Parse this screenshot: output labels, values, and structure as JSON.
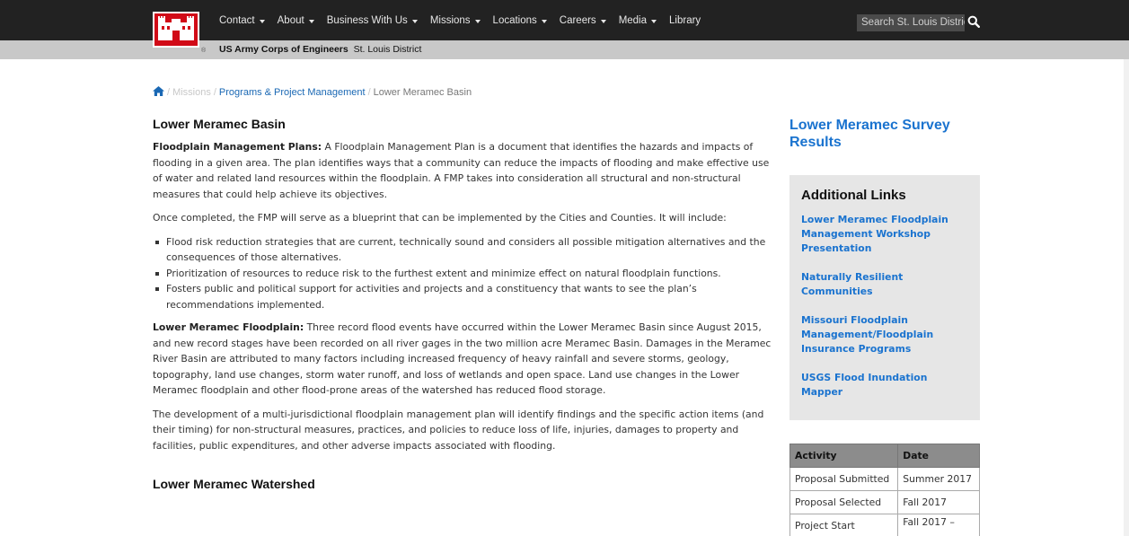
{
  "nav": {
    "items": [
      {
        "label": "Contact",
        "has_dropdown": true
      },
      {
        "label": "About",
        "has_dropdown": true
      },
      {
        "label": "Business With Us",
        "has_dropdown": true
      },
      {
        "label": "Missions",
        "has_dropdown": true
      },
      {
        "label": "Locations",
        "has_dropdown": true
      },
      {
        "label": "Careers",
        "has_dropdown": true
      },
      {
        "label": "Media",
        "has_dropdown": true
      },
      {
        "label": "Library",
        "has_dropdown": false
      }
    ],
    "search_placeholder": "Search St. Louis District",
    "search_icon": "search-icon",
    "org_name": "US Army Corps of Engineers",
    "district": "St. Louis District",
    "logo_reg": "®",
    "colors": {
      "topbar": "#222222",
      "subbar": "#c8c8c8",
      "logo": "#d10a17"
    }
  },
  "breadcrumb": {
    "home_icon": "home-icon",
    "items": [
      "Missions",
      "Programs & Project Management",
      "Lower Meramec Basin"
    ],
    "separator": "/"
  },
  "main": {
    "title": "Lower Meramec Basin",
    "p1_label": "Floodplain Management Plans:",
    "p1_text": " A Floodplain Management Plan is a document that identifies the hazards and impacts of flooding in a given area. The plan identifies ways that a community can reduce the impacts of flooding and make effective use of water and related land resources within the floodplain. A FMP takes into consideration all structural and non-structural measures that could help achieve its objectives.",
    "p2": "Once completed, the FMP will serve as a blueprint that can be implemented by the Cities and Counties. It will include:",
    "bullets": [
      "Flood risk reduction strategies that are current, technically sound and considers all possible mitigation alternatives and the consequences of those alternatives.",
      "Prioritization of resources to reduce risk to the furthest extent and minimize effect on natural floodplain functions.",
      "Fosters public and political support for activities and projects and a constituency that wants to see the plan’s recommendations implemented."
    ],
    "p3_label": "Lower Meramec Floodplain:",
    "p3_text": " Three record flood events have occurred within the Lower Meramec Basin since August 2015, and new record stages have been recorded on all river gages in the two million acre Meramec Basin. Damages in the Meramec River Basin are attributed to many factors including increased frequency of heavy rainfall and severe storms, geology, topography, land use changes, storm water runoff, and loss of wetlands and open space. Land use changes  in the Lower Meramec floodplain and other flood-prone areas of the watershed has reduced flood storage.",
    "p4": "The development of a multi-jurisdictional floodplain management plan will identify findings and the specific action items (and their timing) for non-structural measures, practices, and policies to reduce loss of life, injuries, damages to property and facilities, public expenditures, and other adverse impacts associated with flooding.",
    "subtitle": "Lower Meramec Watershed"
  },
  "sidebar": {
    "survey_link": "Lower Meramec Survey Results",
    "links_title": "Additional Links",
    "links": [
      "Lower Meramec Floodplain Management Workshop Presentation",
      "Naturally Resilient Communities",
      "Missouri Floodplain Management/Floodplain Insurance Programs",
      "USGS Flood Inundation Mapper"
    ],
    "link_color": "#1a73cf",
    "table": {
      "headers": [
        "Activity",
        "Date"
      ],
      "rows": [
        [
          "Proposal Submitted",
          "Summer 2017"
        ],
        [
          "Proposal Selected",
          "Fall 2017"
        ],
        [
          "Project Start",
          "Fall 2017 –"
        ]
      ]
    }
  }
}
